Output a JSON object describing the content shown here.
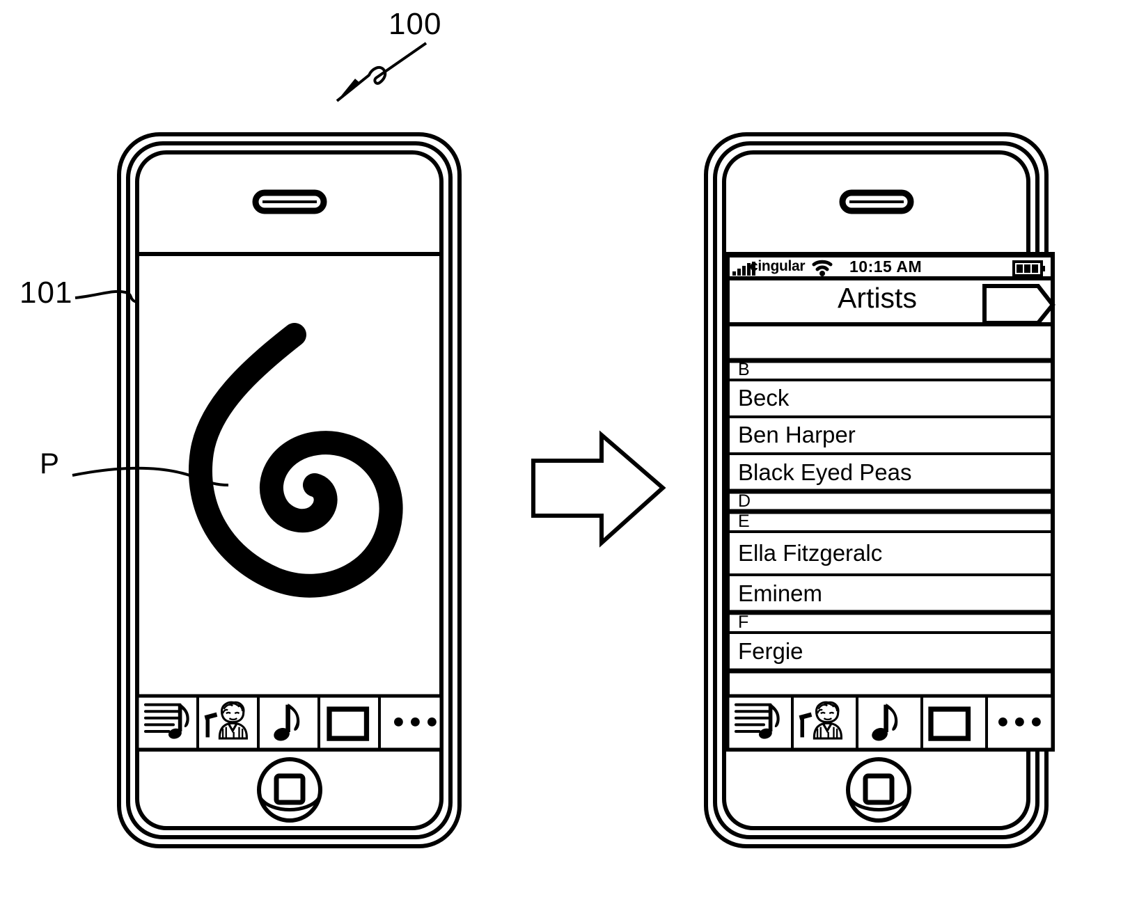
{
  "figure": {
    "type": "patent-figure",
    "reference_numerals": [
      {
        "id": "ref-100",
        "label": "100",
        "points_to": "device"
      },
      {
        "id": "ref-101",
        "label": "101",
        "points_to": "device-edge"
      },
      {
        "id": "ref-p",
        "label": "P",
        "points_to": "spiral-gesture-path"
      }
    ],
    "transition_arrow": {
      "name": "flow-arrow",
      "direction": "right"
    }
  },
  "left_phone": {
    "name": "device-before",
    "speaker": "earpiece-speaker",
    "screen": {
      "gesture": {
        "name": "spiral-gesture",
        "shape": "spiral",
        "label": "P"
      }
    },
    "toolbar": {
      "items": [
        {
          "name": "playlists-tab",
          "icon": "playlist-icon",
          "label": ""
        },
        {
          "name": "artists-tab",
          "icon": "artist-icon",
          "label": ""
        },
        {
          "name": "songs-tab",
          "icon": "music-note-icon",
          "label": ""
        },
        {
          "name": "videos-tab",
          "icon": "video-icon",
          "label": ""
        },
        {
          "name": "more-tab",
          "icon": "more-icon",
          "label": ""
        }
      ]
    },
    "home_button": "home-button"
  },
  "right_phone": {
    "name": "device-after",
    "speaker": "earpiece-speaker",
    "status_bar": {
      "signal_icon": "signal-bars-icon",
      "carrier": "cingular",
      "wifi_icon": "wifi-icon",
      "time": "10:15 AM",
      "battery_icon": "battery-icon"
    },
    "nav_bar": {
      "title": "Artists",
      "right_button": {
        "name": "now-playing-button",
        "icon": "arrow-right-icon",
        "label": ""
      }
    },
    "list": {
      "rows": [
        {
          "type": "section",
          "label": "B"
        },
        {
          "type": "entry",
          "label": "Beck"
        },
        {
          "type": "entry",
          "label": "Ben Harper"
        },
        {
          "type": "entry",
          "label": "Black Eyed Peas"
        },
        {
          "type": "section",
          "label": "D"
        },
        {
          "type": "section",
          "label": "E"
        },
        {
          "type": "entry",
          "label": "Ella Fitzgeralc"
        },
        {
          "type": "entry",
          "label": "Eminem"
        },
        {
          "type": "section",
          "label": "F"
        },
        {
          "type": "entry",
          "label": "Fergie"
        }
      ]
    },
    "toolbar": {
      "items": [
        {
          "name": "playlists-tab",
          "icon": "playlist-icon",
          "label": ""
        },
        {
          "name": "artists-tab",
          "icon": "artist-icon",
          "label": ""
        },
        {
          "name": "songs-tab",
          "icon": "music-note-icon",
          "label": ""
        },
        {
          "name": "videos-tab",
          "icon": "video-icon",
          "label": ""
        },
        {
          "name": "more-tab",
          "icon": "more-icon",
          "label": ""
        }
      ]
    },
    "home_button": "home-button"
  },
  "colors": {
    "ink": "#000000",
    "paper": "#ffffff"
  }
}
